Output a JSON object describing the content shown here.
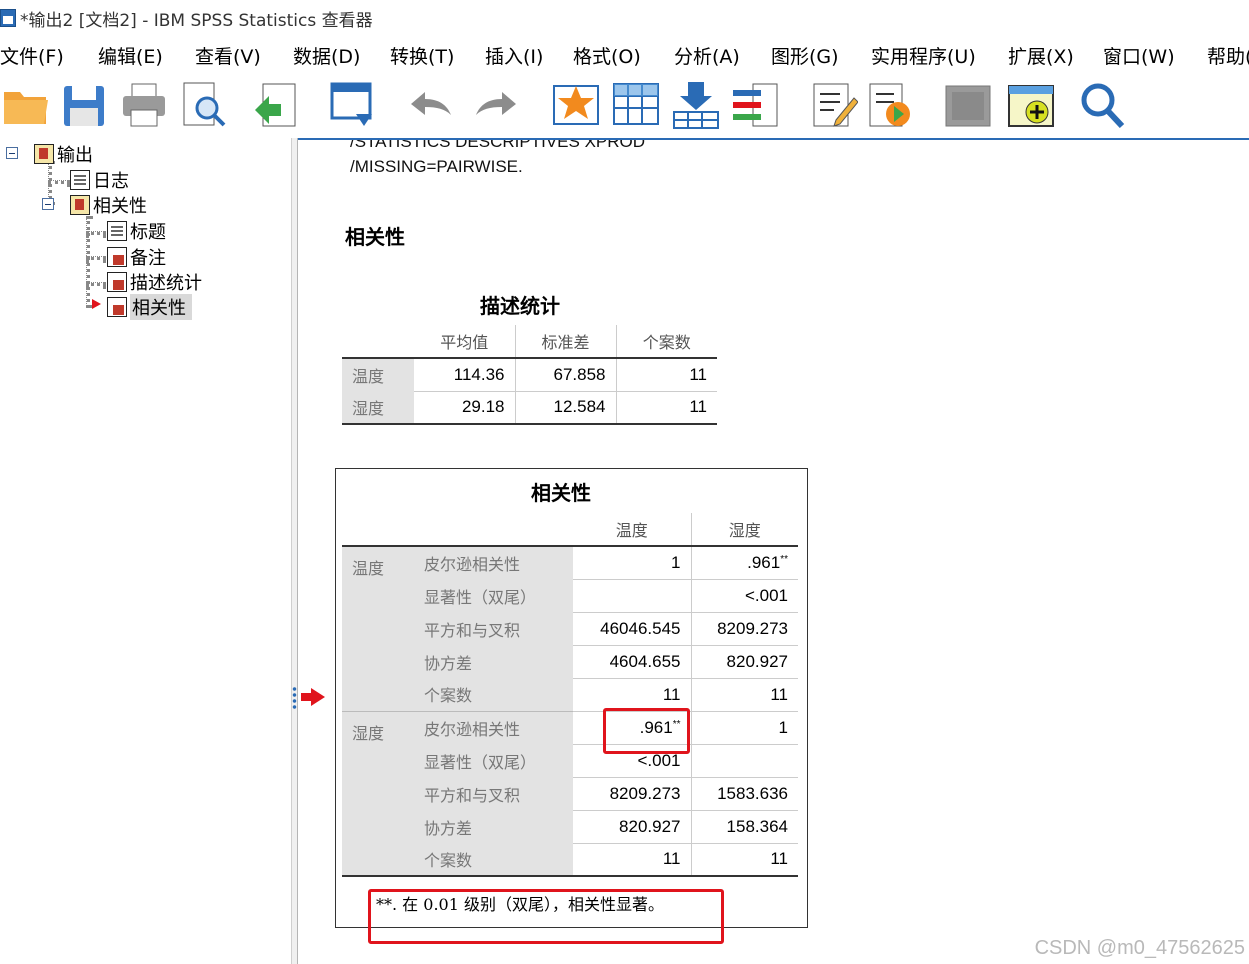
{
  "window": {
    "title": "*输出2 [文档2] - IBM SPSS Statistics 查看器"
  },
  "menu": [
    "文件(F)",
    "编辑(E)",
    "查看(V)",
    "数据(D)",
    "转换(T)",
    "插入(I)",
    "格式(O)",
    "分析(A)",
    "图形(G)",
    "实用程序(U)",
    "扩展(X)",
    "窗口(W)",
    "帮助("
  ],
  "toolbar": {
    "icons": [
      "open-folder-icon",
      "save-icon",
      "print-icon",
      "print-preview-icon",
      "export-icon",
      "recall-dialog-icon",
      "undo-icon",
      "redo-icon",
      "goto-data-icon",
      "goto-case-icon",
      "goto-variable-icon",
      "variables-icon",
      "edit-icon",
      "run-script-icon",
      "hide-icon",
      "insert-output-icon",
      "find-icon"
    ]
  },
  "outline": {
    "root": "输出",
    "items": [
      "日志",
      "相关性"
    ],
    "sub_items": [
      "标题",
      "备注",
      "描述统计",
      "相关性"
    ],
    "selected": "相关性"
  },
  "output": {
    "syntax_partial": "/STATISTICS DESCRIPTIVES XPROD",
    "syntax_line": "/MISSING=PAIRWISE.",
    "section_heading": "相关性",
    "descriptives": {
      "title": "描述统计",
      "columns": [
        "平均值",
        "标准差",
        "个案数"
      ],
      "rows": [
        {
          "label": "温度",
          "mean": "114.36",
          "sd": "67.858",
          "n": "11"
        },
        {
          "label": "湿度",
          "mean": "29.18",
          "sd": "12.584",
          "n": "11"
        }
      ]
    },
    "correlations": {
      "title": "相关性",
      "columns": [
        "温度",
        "湿度"
      ],
      "groups": [
        {
          "label": "温度",
          "rows": [
            {
              "stat": "皮尔逊相关性",
              "v1": "1",
              "v2": ".961",
              "v2_sup": "**"
            },
            {
              "stat": "显著性（双尾）",
              "v1": "",
              "v2": "<.001"
            },
            {
              "stat": "平方和与叉积",
              "v1": "46046.545",
              "v2": "8209.273"
            },
            {
              "stat": "协方差",
              "v1": "4604.655",
              "v2": "820.927"
            },
            {
              "stat": "个案数",
              "v1": "11",
              "v2": "11"
            }
          ]
        },
        {
          "label": "湿度",
          "rows": [
            {
              "stat": "皮尔逊相关性",
              "v1": ".961",
              "v1_sup": "**",
              "v2": "1"
            },
            {
              "stat": "显著性（双尾）",
              "v1": "<.001",
              "v2": ""
            },
            {
              "stat": "平方和与叉积",
              "v1": "8209.273",
              "v2": "1583.636"
            },
            {
              "stat": "协方差",
              "v1": "820.927",
              "v2": "158.364"
            },
            {
              "stat": "个案数",
              "v1": "11",
              "v2": "11"
            }
          ]
        }
      ],
      "footnote": "**. 在 0.01 级别（双尾），相关性显著。"
    }
  },
  "watermark": "CSDN @m0_47562625",
  "colors": {
    "accent": "#2a6bb5",
    "highlight": "#e0141c",
    "label_bg": "#e3e3e3"
  }
}
